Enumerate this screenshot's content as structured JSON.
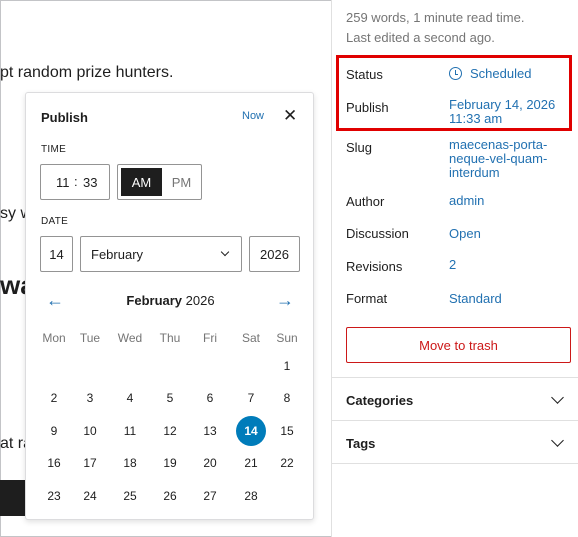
{
  "editor": {
    "line1": "pt random prize hunters.",
    "line2": "sy w",
    "heading": "wa",
    "line3": "at ra"
  },
  "sidebar": {
    "word_count": "259 words, 1 minute read time.",
    "last_edited": "Last edited a second ago.",
    "rows": {
      "status": {
        "label": "Status",
        "value": "Scheduled"
      },
      "publish": {
        "label": "Publish",
        "value_line1": "February 14, 2026",
        "value_line2": "11:33 am"
      },
      "slug": {
        "label": "Slug",
        "value_line1": "maecenas-porta-",
        "value_line2": "neque-vel-quam-",
        "value_line3": "interdum"
      },
      "author": {
        "label": "Author",
        "value": "admin"
      },
      "discussion": {
        "label": "Discussion",
        "value": "Open"
      },
      "revisions": {
        "label": "Revisions",
        "value": "2"
      },
      "format": {
        "label": "Format",
        "value": "Standard"
      }
    },
    "trash_label": "Move to trash",
    "panels": {
      "categories": "Categories",
      "tags": "Tags"
    }
  },
  "popover": {
    "title": "Publish",
    "now_label": "Now",
    "close_glyph": "✕",
    "time_label": "TIME",
    "hour": "11",
    "minute": "33",
    "am": "AM",
    "pm": "PM",
    "date_label": "DATE",
    "day": "14",
    "month": "February",
    "year": "2026",
    "calendar": {
      "month": "February",
      "year": "2026",
      "prev": "←",
      "next": "→",
      "weekdays": [
        "Mon",
        "Tue",
        "Wed",
        "Thu",
        "Fri",
        "Sat",
        "Sun"
      ],
      "selected_day": "14",
      "weeks": [
        [
          "",
          "",
          "",
          "",
          "",
          "",
          "1"
        ],
        [
          "2",
          "3",
          "4",
          "5",
          "6",
          "7",
          "8"
        ],
        [
          "9",
          "10",
          "11",
          "12",
          "13",
          "14",
          "15"
        ],
        [
          "16",
          "17",
          "18",
          "19",
          "20",
          "21",
          "22"
        ],
        [
          "23",
          "24",
          "25",
          "26",
          "27",
          "28",
          ""
        ]
      ]
    }
  },
  "colors": {
    "accent": "#2271b1",
    "selected": "#007cba",
    "danger": "#cc1818",
    "highlight": "#e00000"
  }
}
